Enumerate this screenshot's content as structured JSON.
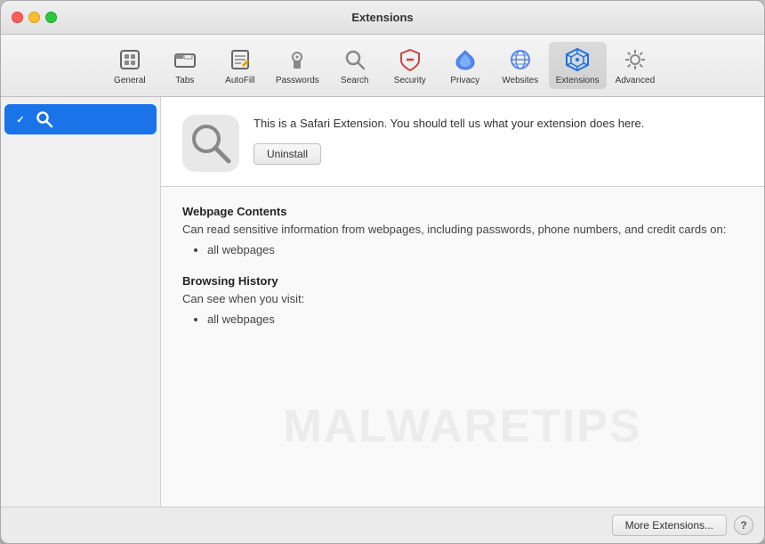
{
  "window": {
    "title": "Extensions"
  },
  "toolbar": {
    "items": [
      {
        "id": "general",
        "label": "General",
        "active": false
      },
      {
        "id": "tabs",
        "label": "Tabs",
        "active": false
      },
      {
        "id": "autofill",
        "label": "AutoFill",
        "active": false
      },
      {
        "id": "passwords",
        "label": "Passwords",
        "active": false
      },
      {
        "id": "search",
        "label": "Search",
        "active": false
      },
      {
        "id": "security",
        "label": "Security",
        "active": false
      },
      {
        "id": "privacy",
        "label": "Privacy",
        "active": false
      },
      {
        "id": "websites",
        "label": "Websites",
        "active": false
      },
      {
        "id": "extensions",
        "label": "Extensions",
        "active": true
      },
      {
        "id": "advanced",
        "label": "Advanced",
        "active": false
      }
    ]
  },
  "sidebar": {
    "items": [
      {
        "id": "search-ext",
        "label": "",
        "checked": true,
        "selected": true
      }
    ]
  },
  "extension": {
    "description": "This is a Safari Extension. You should tell us what your extension does here.",
    "uninstall_label": "Uninstall"
  },
  "permissions": {
    "groups": [
      {
        "id": "webpage-contents",
        "title": "Webpage Contents",
        "description": "Can read sensitive information from webpages, including passwords, phone numbers, and credit cards on:",
        "items": [
          "all webpages"
        ]
      },
      {
        "id": "browsing-history",
        "title": "Browsing History",
        "description": "Can see when you visit:",
        "items": [
          "all webpages"
        ]
      }
    ]
  },
  "bottom_bar": {
    "more_extensions_label": "More Extensions...",
    "help_label": "?"
  },
  "watermark": {
    "text": "MALWARETIPS"
  }
}
